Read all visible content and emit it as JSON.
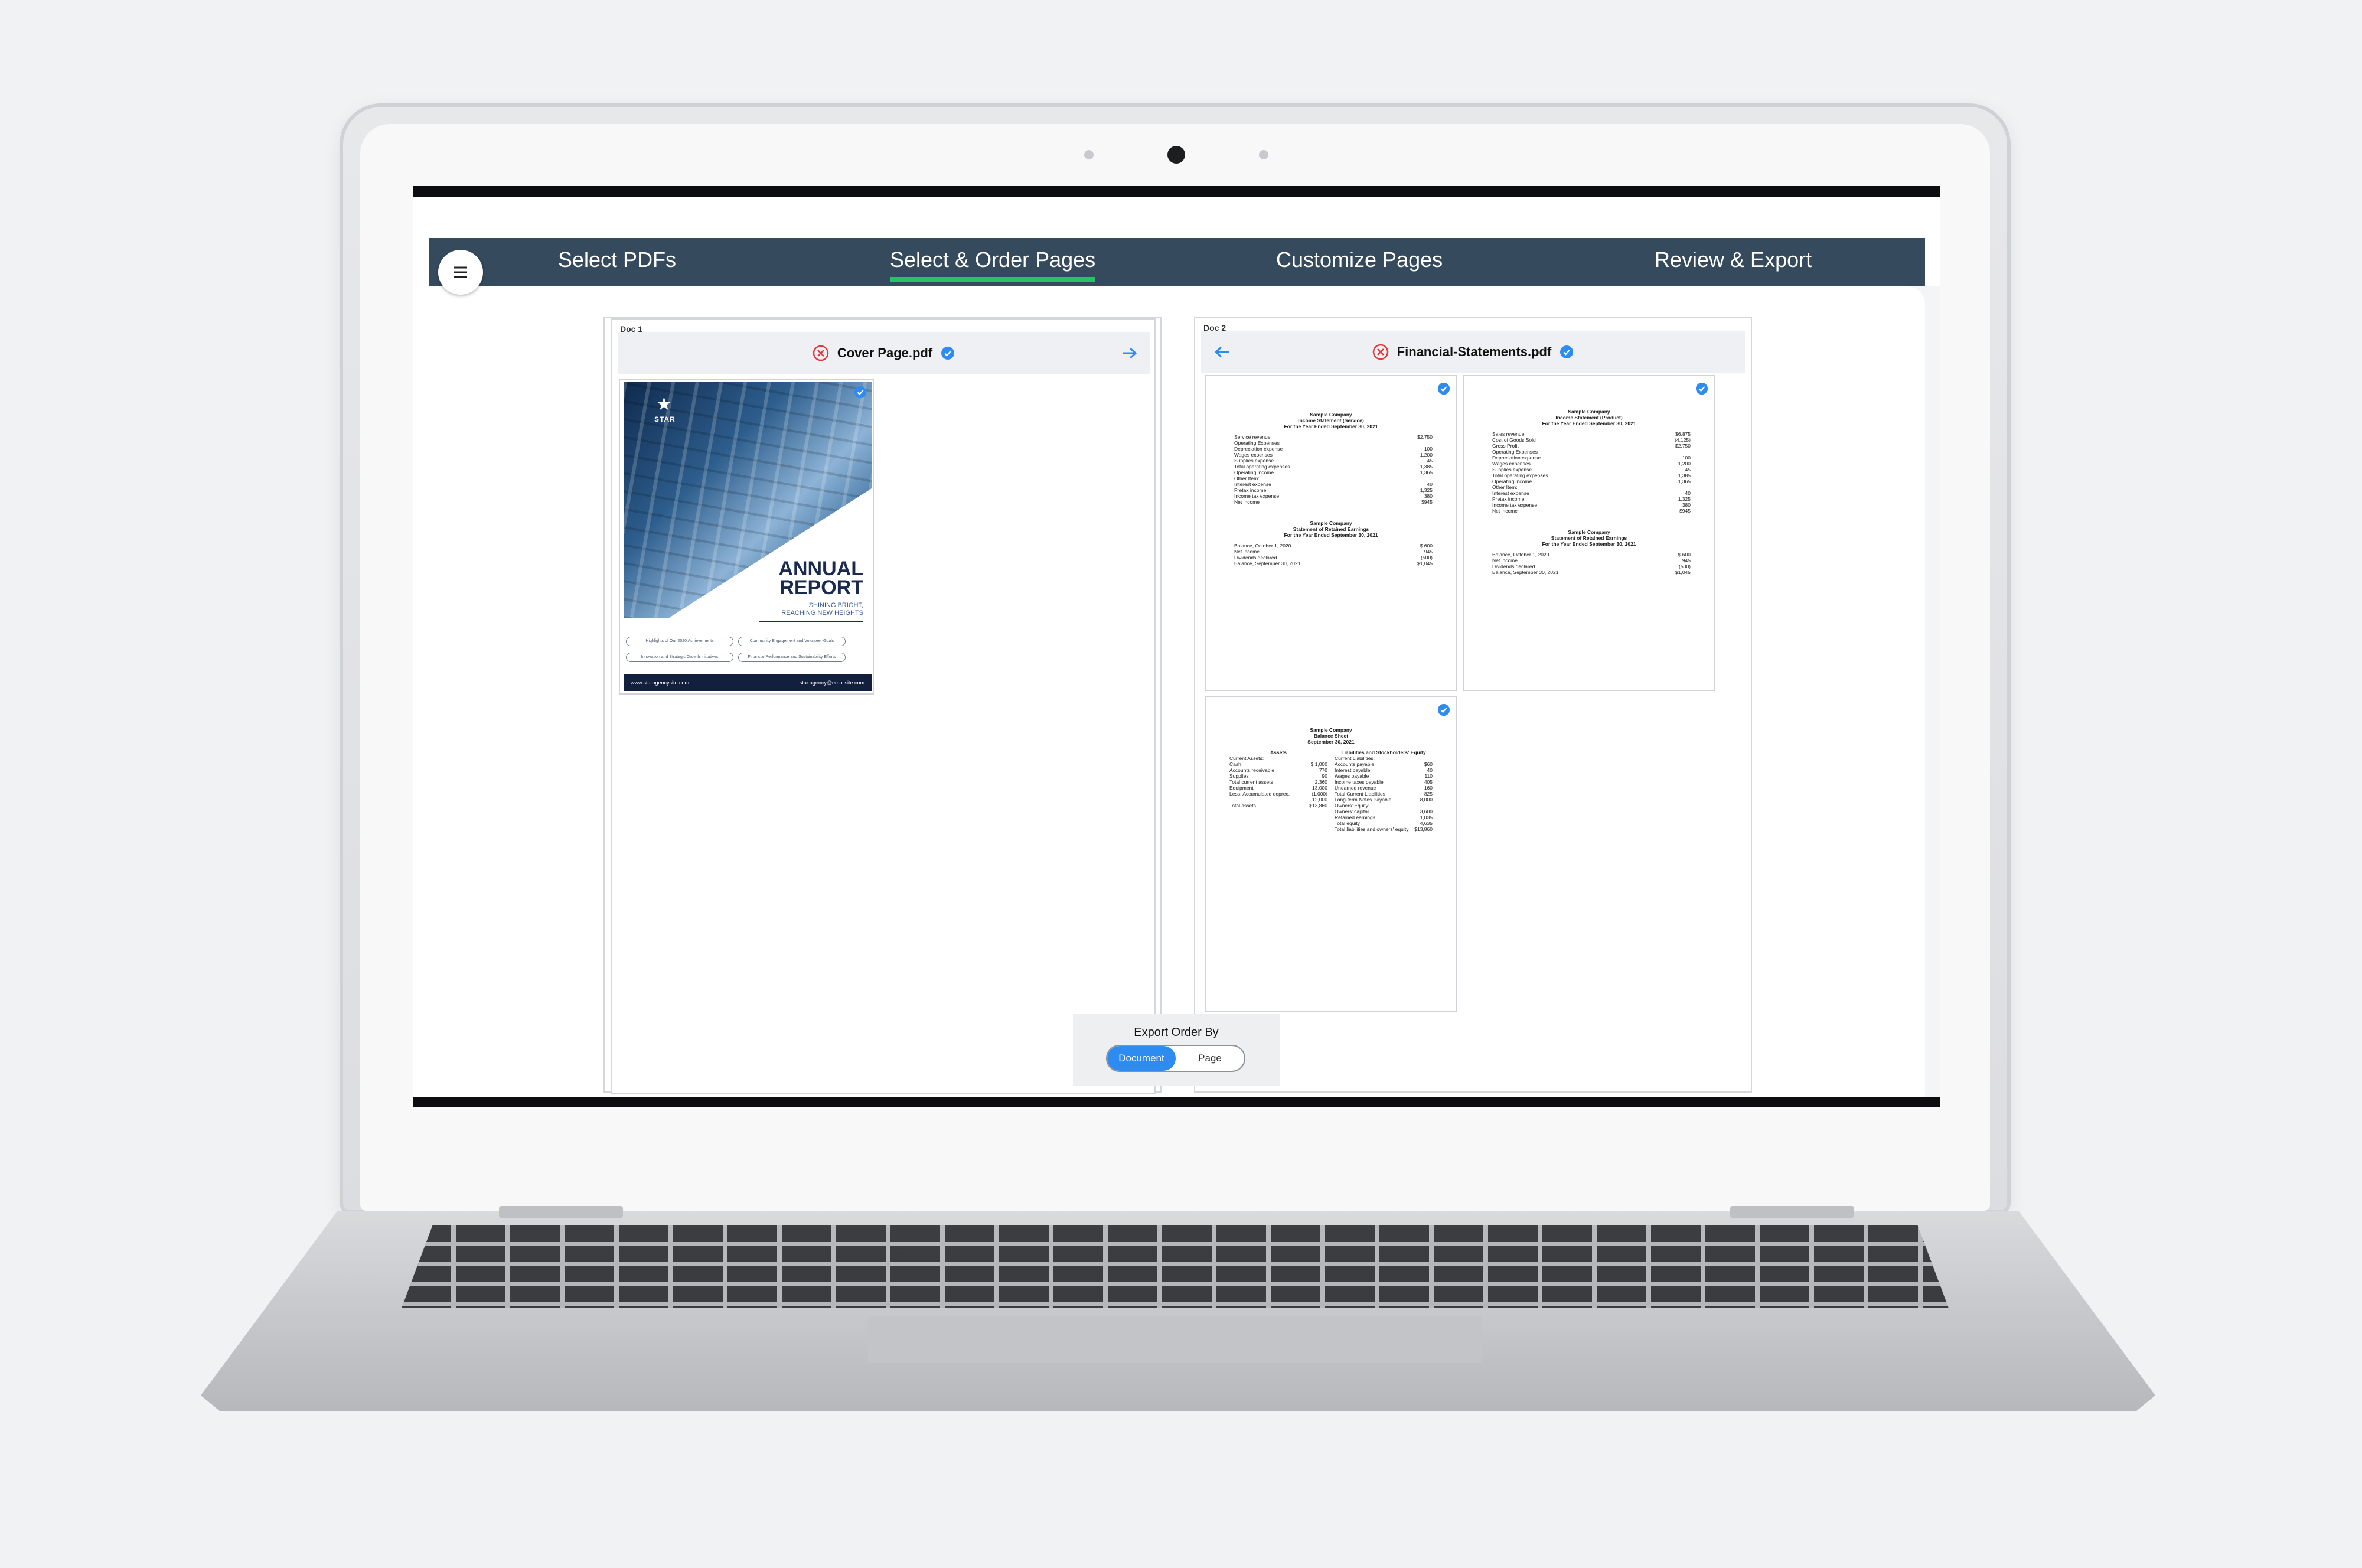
{
  "nav": {
    "steps": [
      "Select PDFs",
      "Select & Order Pages",
      "Customize Pages",
      "Review & Export"
    ],
    "active_index": 1
  },
  "doc1": {
    "tag": "Doc 1",
    "title": "Cover Page.pdf",
    "cover": {
      "brand": "STAR",
      "title_line1": "ANNUAL",
      "title_line2": "REPORT",
      "subtitle_line1": "SHINING BRIGHT,",
      "subtitle_line2": "REACHING NEW HEIGHTS",
      "pills": [
        "Highlights of Our 2020 Achievements",
        "Community Engagement and Volunteer Goals",
        "Innovation and Strategic Growth Initiatives",
        "Financial Performance and Sustainability Efforts"
      ],
      "footer_left": "www.staragencysite.com",
      "footer_right": "star.agency@emailsite.com"
    }
  },
  "doc2": {
    "tag": "Doc 2",
    "title": "Financial-Statements.pdf",
    "pages": [
      {
        "company": "Sample Company",
        "statement": "Income Statement (Service)",
        "period": "For the Year Ended September 30, 2021",
        "rows": [
          [
            "Service revenue",
            "$2,750"
          ],
          [
            "Operating Expenses",
            ""
          ],
          [
            "Depreciation expense",
            "100"
          ],
          [
            "Wages expenses",
            "1,200"
          ],
          [
            "Supplies expense",
            "45"
          ],
          [
            "Total operating expenses",
            "1,385"
          ],
          [
            "Operating income",
            "1,365"
          ],
          [
            "Other Item:",
            ""
          ],
          [
            "Interest expense",
            "40"
          ],
          [
            "Pretax income",
            "1,325"
          ],
          [
            "Income tax expense",
            "380"
          ],
          [
            "Net income",
            "$945"
          ]
        ],
        "second_title": "Statement of Retained Earnings",
        "second_rows": [
          [
            "Balance, October 1, 2020",
            "$ 600"
          ],
          [
            "Net income",
            "945"
          ],
          [
            "Dividends declared",
            "(500)"
          ],
          [
            "Balance, September 30, 2021",
            "$1,045"
          ]
        ]
      },
      {
        "company": "Sample Company",
        "statement": "Income Statement (Product)",
        "period": "For the Year Ended September 30, 2021",
        "rows": [
          [
            "Sales revenue",
            "$6,875"
          ],
          [
            "Cost of Goods Sold",
            "(4,125)"
          ],
          [
            "Gross Profit",
            "$2,750"
          ],
          [
            "Operating Expenses",
            ""
          ],
          [
            "Depreciation expense",
            "100"
          ],
          [
            "Wages expenses",
            "1,200"
          ],
          [
            "Supplies expense",
            "45"
          ],
          [
            "Total operating expenses",
            "1,385"
          ],
          [
            "Operating income",
            "1,365"
          ],
          [
            "Other Item:",
            ""
          ],
          [
            "Interest expense",
            "40"
          ],
          [
            "Pretax income",
            "1,325"
          ],
          [
            "Income tax expense",
            "380"
          ],
          [
            "Net income",
            "$945"
          ]
        ],
        "second_title": "Statement of Retained Earnings",
        "second_rows": [
          [
            "Balance, October 1, 2020",
            "$ 600"
          ],
          [
            "Net income",
            "945"
          ],
          [
            "Dividends declared",
            "(500)"
          ],
          [
            "Balance, September 30, 2021",
            "$1,045"
          ]
        ]
      },
      {
        "company": "Sample Company",
        "statement": "Balance Sheet",
        "period": "September 30, 2021",
        "left_head": "Assets",
        "right_head": "Liabilities and Stockholders' Equity",
        "left_rows": [
          [
            "Current Assets:",
            ""
          ],
          [
            "Cash",
            "$ 1,000"
          ],
          [
            "Accounts receivable",
            "770"
          ],
          [
            "Supplies",
            "90"
          ],
          [
            "Total current assets",
            "2,360"
          ],
          [
            "Equipment",
            "13,000"
          ],
          [
            "Less: Accumulated deprec.",
            "(1,000)"
          ],
          [
            "",
            "12,000"
          ],
          [
            "Total assets",
            "$13,860"
          ]
        ],
        "right_rows": [
          [
            "Current Liabilities:",
            ""
          ],
          [
            "Accounts payable",
            "$60"
          ],
          [
            "Interest payable",
            "40"
          ],
          [
            "Wages payable",
            "110"
          ],
          [
            "Income taxes payable",
            "405"
          ],
          [
            "Unearned revenue",
            "160"
          ],
          [
            "Total Current Liabilities",
            "825"
          ],
          [
            "Long-term Notes Payable",
            "8,000"
          ],
          [
            "Owners' Equity:",
            ""
          ],
          [
            "Owners' capital",
            "3,600"
          ],
          [
            "Retained earnings",
            "1,035"
          ],
          [
            "Total equity",
            "4,635"
          ],
          [
            "Total liabilities and owners' equity",
            "$13,860"
          ]
        ]
      }
    ]
  },
  "export": {
    "label": "Export Order By",
    "options": [
      "Document",
      "Page"
    ],
    "selected": "Document"
  },
  "colors": {
    "navbar": "#364a5e",
    "active_underline": "#27c266",
    "accent_blue": "#2e8bf0",
    "remove_red": "#e03b3b"
  }
}
